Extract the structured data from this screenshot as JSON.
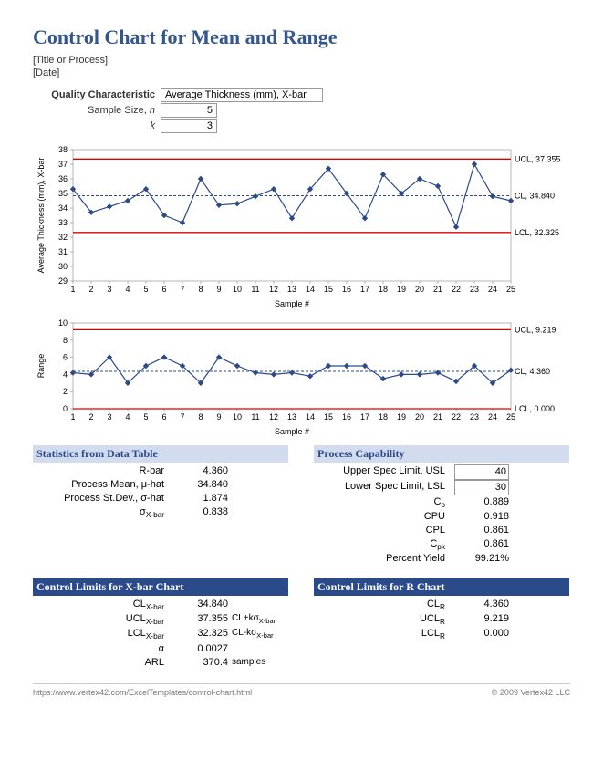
{
  "header": {
    "title": "Control Chart for Mean and Range",
    "subtitle1": "[Title or Process]",
    "subtitle2": "[Date]"
  },
  "params": {
    "quality_label": "Quality Characteristic",
    "quality_value": "Average Thickness (mm), X-bar",
    "sample_size_label": "Sample Size, n",
    "sample_size_value": "5",
    "k_label": "k",
    "k_value": "3"
  },
  "chart_data": [
    {
      "type": "line",
      "title": "X-bar Chart",
      "xlabel": "Sample #",
      "ylabel": "Average Thickness (mm), X-bar",
      "x": [
        1,
        2,
        3,
        4,
        5,
        6,
        7,
        8,
        9,
        10,
        11,
        12,
        13,
        14,
        15,
        16,
        17,
        18,
        19,
        20,
        21,
        22,
        23,
        24,
        25
      ],
      "values": [
        35.3,
        33.7,
        34.1,
        34.5,
        35.3,
        33.5,
        33.0,
        36.0,
        34.2,
        34.3,
        34.8,
        35.3,
        33.3,
        35.3,
        36.7,
        35.0,
        33.3,
        36.3,
        35.0,
        36.0,
        35.5,
        32.7,
        37.0,
        34.8,
        34.5
      ],
      "center_line": 34.84,
      "ucl": 37.355,
      "lcl": 32.325,
      "ylim": [
        29,
        38
      ],
      "yticks": [
        29,
        30,
        31,
        32,
        33,
        34,
        35,
        36,
        37,
        38
      ],
      "annotations": {
        "ucl": "UCL, 37.355",
        "cl": "CL, 34.840",
        "lcl": "LCL, 32.325"
      }
    },
    {
      "type": "line",
      "title": "R Chart",
      "xlabel": "Sample #",
      "ylabel": "Range",
      "x": [
        1,
        2,
        3,
        4,
        5,
        6,
        7,
        8,
        9,
        10,
        11,
        12,
        13,
        14,
        15,
        16,
        17,
        18,
        19,
        20,
        21,
        22,
        23,
        24,
        25
      ],
      "values": [
        4.2,
        4.0,
        6.0,
        3.0,
        5.0,
        6.0,
        5.0,
        3.0,
        6.0,
        5.0,
        4.2,
        4.0,
        4.2,
        3.8,
        5.0,
        5.0,
        5.0,
        3.5,
        4.0,
        4.0,
        4.2,
        3.2,
        5.0,
        3.0,
        4.5
      ],
      "center_line": 4.36,
      "ucl": 9.219,
      "lcl": 0.0,
      "ylim": [
        0,
        10
      ],
      "yticks": [
        0,
        2,
        4,
        6,
        8,
        10
      ],
      "annotations": {
        "ucl": "UCL, 9.219",
        "cl": "CL, 4.360",
        "lcl": "LCL, 0.000"
      }
    }
  ],
  "stats_table": {
    "header": "Statistics from Data Table",
    "rows": [
      {
        "label": "R-bar",
        "value": "4.360"
      },
      {
        "label": "Process Mean, μ-hat",
        "value": "34.840"
      },
      {
        "label": "Process St.Dev., σ-hat",
        "value": "1.874"
      },
      {
        "label": "σ<sub>X-bar</sub>",
        "value": "0.838"
      }
    ]
  },
  "process_capability": {
    "header": "Process Capability",
    "usl_label": "Upper Spec Limit, USL",
    "usl_value": "40",
    "lsl_label": "Lower Spec Limit, LSL",
    "lsl_value": "30",
    "rows": [
      {
        "label": "C<sub>p</sub>",
        "value": "0.889"
      },
      {
        "label": "CPU",
        "value": "0.918"
      },
      {
        "label": "CPL",
        "value": "0.861"
      },
      {
        "label": "C<sub>pk</sub>",
        "value": "0.861"
      },
      {
        "label": "Percent Yield",
        "value": "99.21%"
      }
    ]
  },
  "xbar_limits": {
    "header": "Control Limits for X-bar Chart",
    "rows": [
      {
        "label": "CL<sub>X-bar</sub>",
        "value": "34.840",
        "extra": ""
      },
      {
        "label": "UCL<sub>X-bar</sub>",
        "value": "37.355",
        "extra": "CL+kσ<sub>X-bar</sub>"
      },
      {
        "label": "LCL<sub>X-bar</sub>",
        "value": "32.325",
        "extra": "CL-kσ<sub>X-bar</sub>"
      },
      {
        "label": "α",
        "value": "0.0027",
        "extra": ""
      },
      {
        "label": "ARL",
        "value": "370.4",
        "extra": "samples"
      }
    ]
  },
  "r_limits": {
    "header": "Control Limits for R Chart",
    "rows": [
      {
        "label": "CL<sub>R</sub>",
        "value": "4.360"
      },
      {
        "label": "UCL<sub>R</sub>",
        "value": "9.219"
      },
      {
        "label": "LCL<sub>R</sub>",
        "value": "0.000"
      }
    ]
  },
  "footer": {
    "url": "https://www.vertex42.com/ExcelTemplates/control-chart.html",
    "copyright": "© 2009 Vertex42 LLC"
  }
}
